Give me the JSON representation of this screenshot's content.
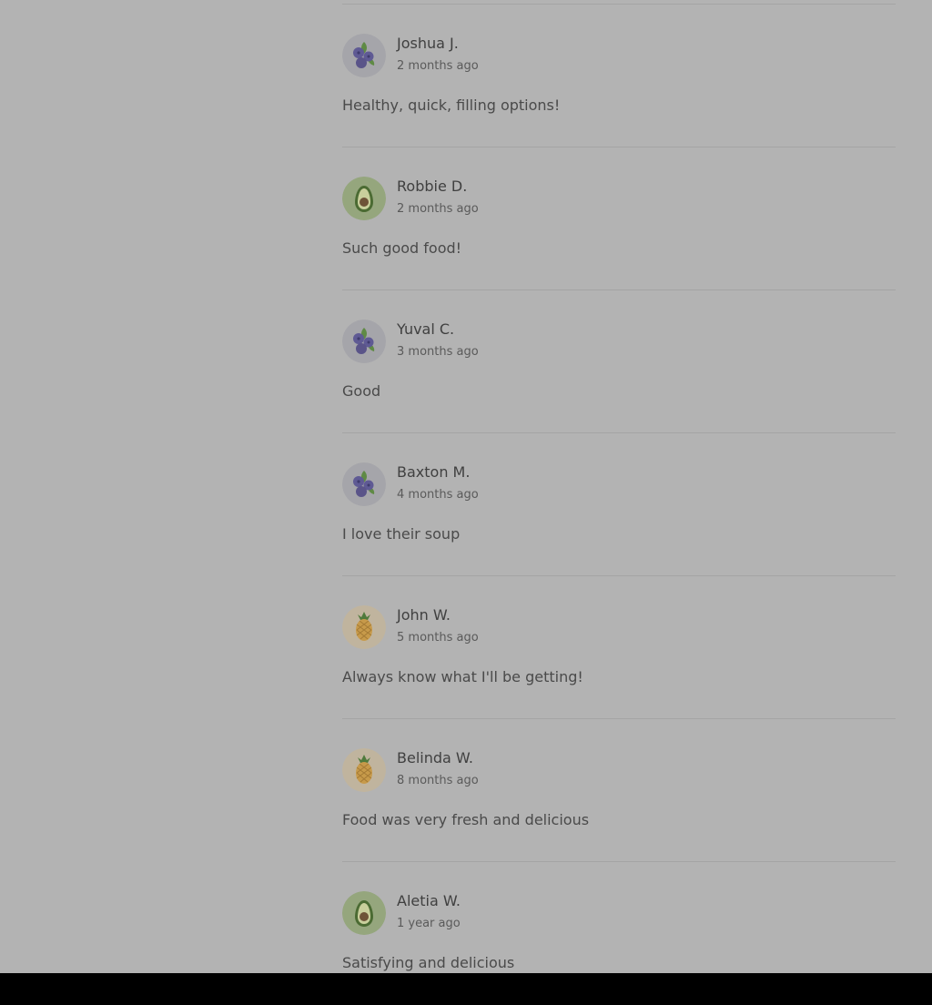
{
  "reviews": [
    {
      "name": "Joshua J.",
      "time": "2 months ago",
      "text": "Healthy, quick, filling options!",
      "avatar": "blueberry-icon"
    },
    {
      "name": "Robbie D.",
      "time": "2 months ago",
      "text": "Such good food!",
      "avatar": "avocado-icon"
    },
    {
      "name": "Yuval C.",
      "time": "3 months ago",
      "text": "Good",
      "avatar": "blueberry-icon"
    },
    {
      "name": "Baxton M.",
      "time": "4 months ago",
      "text": "I love their soup",
      "avatar": "blueberry-icon"
    },
    {
      "name": "John W.",
      "time": "5 months ago",
      "text": "Always know what I'll be getting!",
      "avatar": "pineapple-icon"
    },
    {
      "name": "Belinda W.",
      "time": "8 months ago",
      "text": "Food was very fresh and delicious",
      "avatar": "pineapple-icon"
    },
    {
      "name": "Aletia W.",
      "time": "1 year ago",
      "text": "Satisfying and delicious",
      "avatar": "avocado-icon"
    }
  ],
  "colors": {
    "overlay_background": "#b3b3b3",
    "blueberry_bg": "#a5a5aa",
    "avocado_bg": "#95a67d",
    "pineapple_bg": "#c0b49e"
  }
}
